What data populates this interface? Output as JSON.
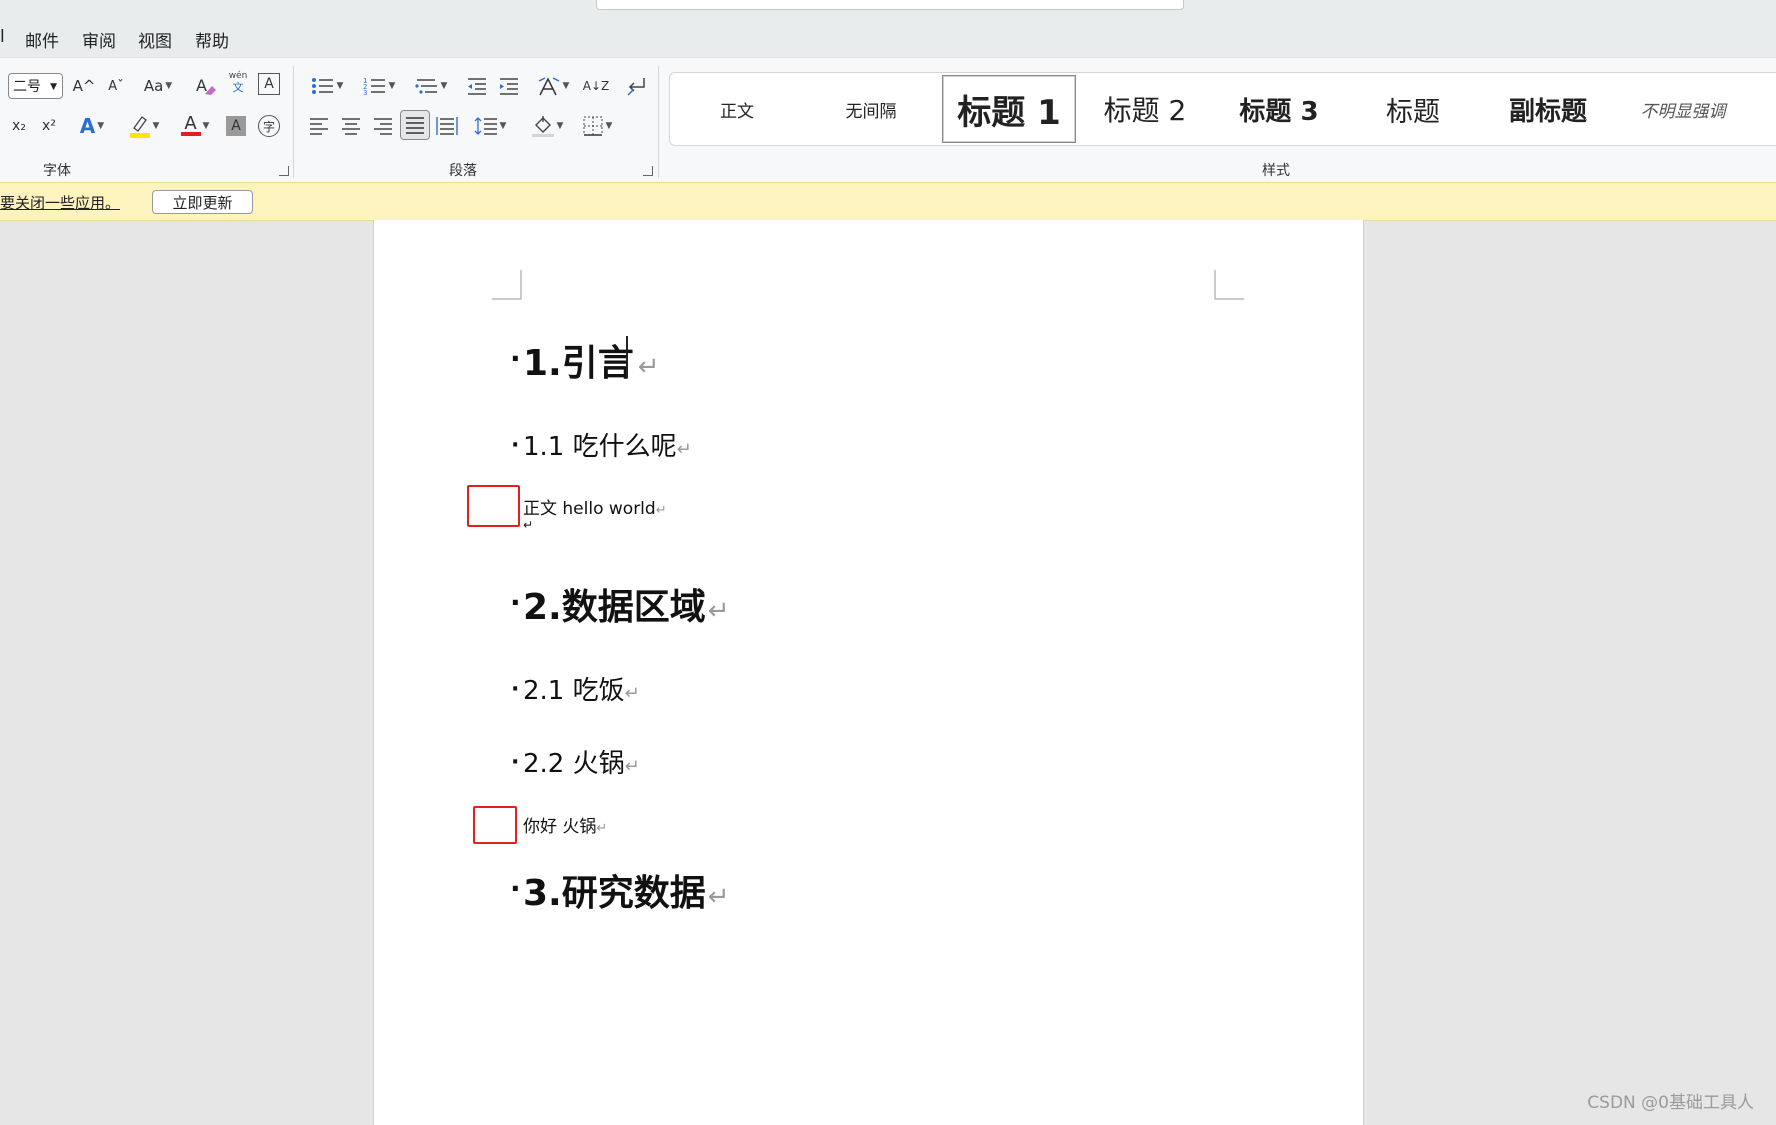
{
  "menu": {
    "edge": "l",
    "items": [
      "邮件",
      "审阅",
      "视图",
      "帮助"
    ]
  },
  "ribbon": {
    "font_group": {
      "label": "字体",
      "font_size": "二号",
      "grow_font": "A^",
      "shrink_font": "Aˇ",
      "change_case": "Aa",
      "phonetic": "wén",
      "phonetic_sub": "文",
      "char_border": "A",
      "subscript": "x₂",
      "superscript": "x²",
      "text_effect": "A",
      "font_color": "A",
      "char_shading": "A",
      "enclose": "字"
    },
    "paragraph_group": {
      "label": "段落",
      "sort": "A↓Z"
    },
    "styles_group": {
      "label": "样式",
      "items": [
        "正文",
        "无间隔",
        "标题 1",
        "标题 2",
        "标题 3",
        "标题",
        "副标题",
        "不明显强调"
      ]
    }
  },
  "notice": {
    "text": "要关闭一些应用。",
    "button": "立即更新"
  },
  "document": {
    "h1_1": "1.引言",
    "h2_1": "1.1  吃什么呢",
    "body_1": "正文  hello world",
    "h1_2": "2.数据区域",
    "h2_2": "2.1 吃饭",
    "h2_3": "2.2 火锅",
    "body_2": "你好  火锅",
    "h1_3": "3.研究数据",
    "para_mark": "↵",
    "bullet": "·"
  },
  "watermark": "CSDN @0基础工具人",
  "colors": {
    "highlight": "#ffe600",
    "font_color": "#e02020",
    "text_effect": "#2a6fd6",
    "mark_box": "#e02020"
  }
}
